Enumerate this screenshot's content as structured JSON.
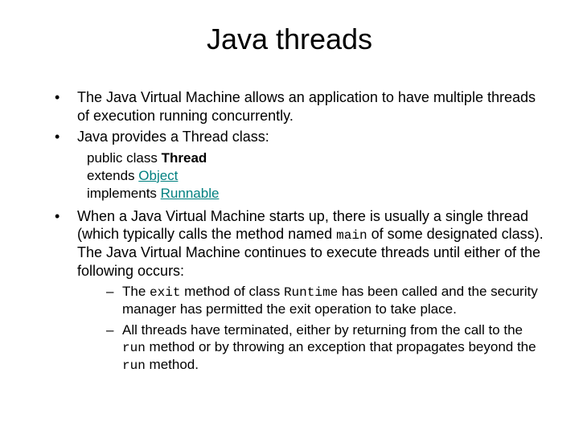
{
  "title": "Java threads",
  "bullets": {
    "b1": "The Java Virtual Machine allows an application to have multiple threads of execution running concurrently.",
    "b2": "Java provides a Thread class:",
    "code": {
      "l1a": "public class ",
      "l1b": "Thread",
      "l2a": "extends ",
      "l2b": "Object",
      "l3a": "implements ",
      "l3b": "Runnable"
    },
    "b3_pre": " When a Java Virtual Machine starts up, there is usually a single thread (which typically calls the method named ",
    "b3_main": "main",
    "b3_post": " of some designated class). The Java Virtual Machine continues to execute threads until either of the following occurs:",
    "sub1_pre": "The ",
    "sub1_exit": "exit",
    "sub1_mid": " method of class ",
    "sub1_runtime": "Runtime",
    "sub1_post": " has been called and the security manager has permitted the exit operation to take place.",
    "sub2_pre": "All threads have terminated, either by returning from the call to the ",
    "sub2_run1": "run",
    "sub2_mid": " method or by throwing an exception that propagates beyond the ",
    "sub2_run2": "run",
    "sub2_post": " method."
  }
}
